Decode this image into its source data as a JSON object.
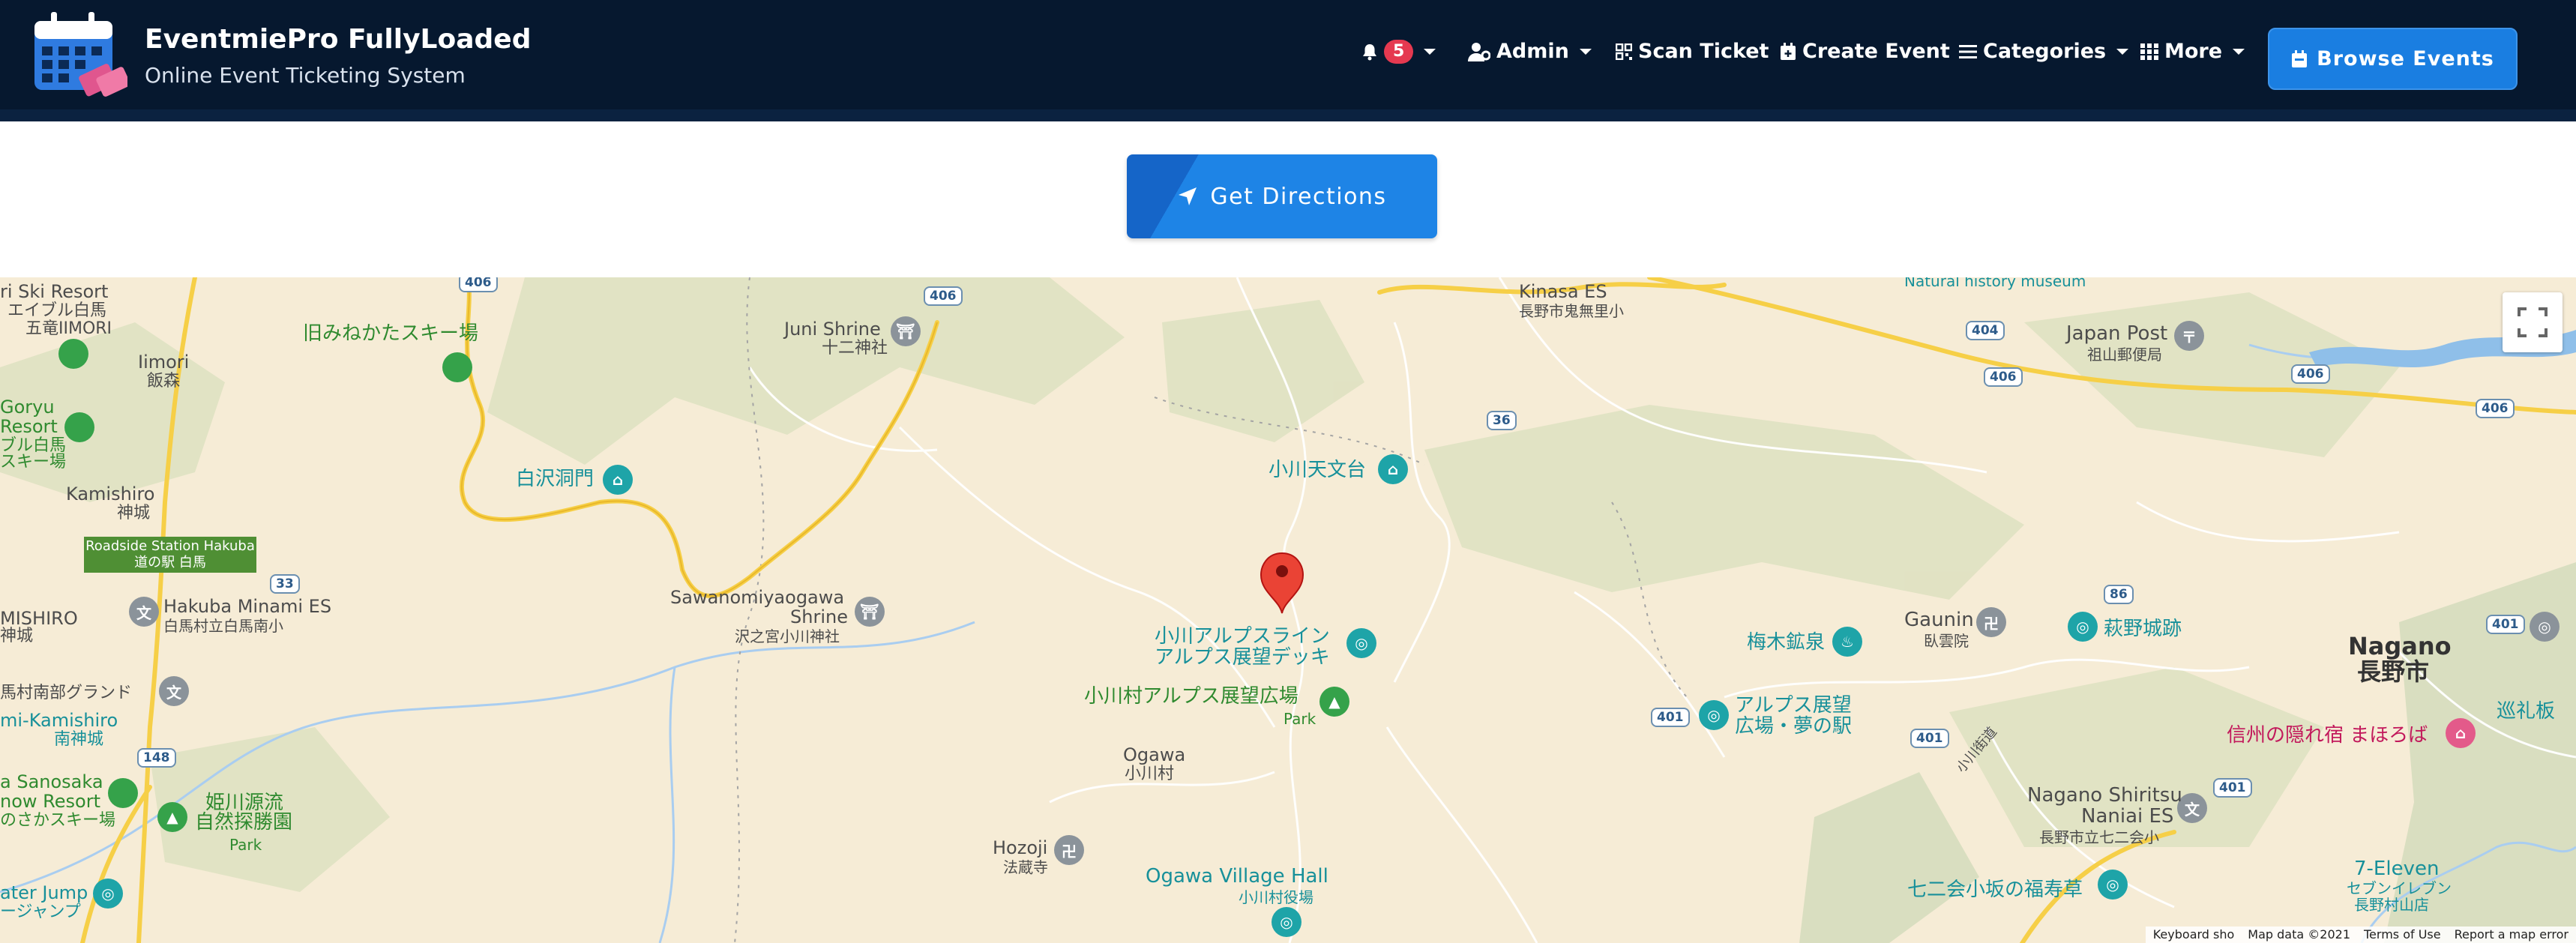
{
  "header": {
    "brand_title": "EventmiePro FullyLoaded",
    "brand_subtitle": "Online Event Ticketing System",
    "notification_count": "5",
    "nav": {
      "admin": "Admin",
      "scan_ticket": "Scan Ticket",
      "create_event": "Create Event",
      "categories": "Categories",
      "more": "More"
    },
    "browse_events": "Browse Events"
  },
  "directions": {
    "button_label": "Get Directions"
  },
  "map": {
    "labels": {
      "ski_resort_top": "ri Ski Resort",
      "eiburu": "エイブル白馬",
      "goryu_imori": "五竜IIMORI",
      "iimori": "Iimori",
      "iimori_jp": "飯森",
      "kyu_mine": "旧みねかたスキー場",
      "juni_shrine": "Juni Shrine",
      "juni_shrine_jp": "十二神社",
      "goryu": "Goryu",
      "resort": "Resort",
      "buru_haku": "ブル白馬",
      "ski_jo": "スキー場",
      "shirasawa": "白沢洞門",
      "kamishiro": "Kamishiro",
      "kamishiro_jp": "神城",
      "station_sign_en": "Roadside Station Hakuba",
      "station_sign_jp": "道の駅 白馬",
      "mishiro": "MISHIRO",
      "mishiro_jp": "神城",
      "hakuba_minami": "Hakuba Minami ES",
      "hakuba_minami_jp": "白馬村立白馬南小",
      "sawanomiya": "Sawanomiyaogawa",
      "shrine": "Shrine",
      "sawanomiya_jp": "沢之宮小川神社",
      "nanbu": "馬村南部グランド",
      "mi_kamishiro": "mi-Kamishiro",
      "minami_kamishiro": "南神城",
      "sanosaka": "a Sanosaka",
      "now_resort": "now Resort",
      "saka_ski": "のさかスキー場",
      "himekawa": "姫川源流",
      "shizen": "自然探勝園",
      "park": "Park",
      "jump": "ater Jump",
      "jump_jp": "ージャンプ",
      "hozoji": "Hozoji",
      "hozoji_jp": "法蔵寺",
      "ogawa": "Ogawa",
      "ogawa_jp": "小川村",
      "ogawa_hall": "Ogawa Village Hall",
      "ogawa_hall_jp": "小川村役場",
      "kinasa": "Kinasa ES",
      "kinasa_jp": "長野市鬼無里小",
      "nat_museum": "Natural history museum",
      "observatory": "小川天文台",
      "alps_line": "小川アルプスライン",
      "alps_deck": "アルプス展望デッキ",
      "ogawa_plaza": "小川村アルプス展望広場",
      "park2": "Park",
      "japan_post": "Japan Post",
      "japan_post_jp": "祖山郵便局",
      "umeki": "梅木鉱泉",
      "gaunin": "Gaunin",
      "gaunin_jp": "臥雲院",
      "hagino": "萩野城跡",
      "nagano": "Nagano",
      "nagano_jp": "長野市",
      "alps_view1": "アルプス展望",
      "alps_view2": "広場・夢の駅",
      "junreizaka": "巡礼板",
      "hotel": "信州の隠れ宿 まほろば",
      "ogawa_road": "小川街道",
      "naniai": "Nagano Shiritsu",
      "naniai2": "Naniai ES",
      "naniai_jp": "長野市立七二会小",
      "seven": "7-Eleven",
      "seven_jp1": "セブンイレブン",
      "seven_jp2": "長野村山店",
      "fukuju": "七二会小坂の福寿草"
    },
    "routes": [
      "406",
      "406",
      "404",
      "406",
      "406",
      "406",
      "36",
      "33",
      "86",
      "401",
      "401",
      "401",
      "401",
      "148"
    ],
    "footer": {
      "keyboard": "Keyboard sho",
      "map_data": "Map data ©2021",
      "terms": "Terms of Use",
      "report": "Report a map error"
    }
  },
  "colors": {
    "header_bg": "#06182f",
    "accent_blue": "#1e84e6",
    "map_land": "#f6ecd6",
    "forest": "#dde3c3",
    "road_yellow": "#f6cf47",
    "marker_red": "#ea4335"
  },
  "icons": [
    "calendar-logo-icon",
    "bell-icon",
    "user-cog-icon",
    "qr-icon",
    "calendar-plus-icon",
    "list-icon",
    "grid-icon",
    "calendar-check-icon",
    "location-arrow-icon",
    "map-pin-icon",
    "fullscreen-icon"
  ]
}
